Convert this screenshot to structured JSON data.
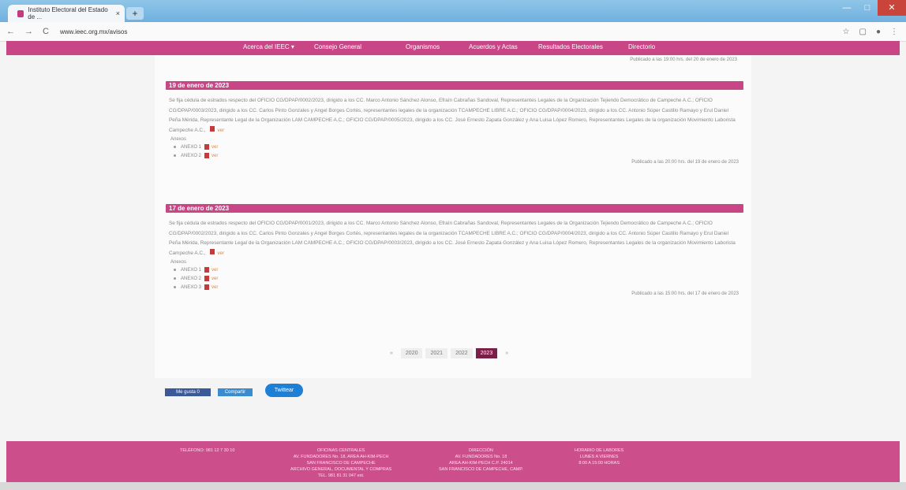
{
  "browser": {
    "tab_title": "Instituto Electoral del Estado de ...",
    "tab_close": "×",
    "new_tab": "+",
    "address": "www.ieec.org.mx/avisos",
    "nav_back": "←",
    "nav_forward": "→",
    "nav_reload": "C",
    "window_minimize": "—",
    "window_maximize": "□",
    "window_close": "✕"
  },
  "topnav": {
    "items": [
      "Acerca del IEEC ▾",
      "Consejo General",
      "Organismos",
      "Acuerdos y Actas",
      "Resultados Electorales",
      "Directorio"
    ]
  },
  "content": {
    "top_published": "Publicado a las 19:00 hrs. del 20 de enero de 2023",
    "entries": [
      {
        "date": "19 de enero de 2023",
        "text": "Se fija cédula de estrados respecto del OFICIO CG/DPAP/0002/2023, dirigido a los CC. Marco Antonio Sánchez Alonso, Efraín Cabrañas Sandoval, Representantes Legales de la Organización Tejiendo Democrático de Campeche A.C.; OFICIO CG/DPAP/0003/2023, dirigido a los CC. Carlos Pinto Gonzales y Angel Borges Cortés, representantes legales de la organización TCAMPECHE LIBRE A.C.; OFICIO CG/DPAP/0004/2023, dirigido a los CC. Antonio Súper Castillo Ramayo y Erul Daniel Peña Mérida, Representante Legal de la Organización LAM CAMPECHE A.C.; OFICIO CG/DPAP/0005/2023, dirigido a los CC. José Ernesto Zapata González y Ana Luisa López Romero, Representantes Legales de la organización Movimiento Laborista Campeche A.C.,",
        "ver": "ver",
        "anexos_label": "Anexos",
        "anexos": [
          "ANEXO 1",
          "ANEXO 2"
        ],
        "published": "Publicado a las 20:00 hrs. del 19 de enero de 2023"
      },
      {
        "date": "17 de enero de 2023",
        "text": "Se fija cédula de estrados respecto del OFICIO CG/DPAP/0001/2023, dirigido a los CC. Marco Antonio Sánchez Alonso, Efraín Cabrañas Sandoval, Representantes Legales de la Organización Tejiendo Democrático de Campeche A.C.; OFICIO CG/DPAP/0002/2023, dirigido a los CC. Carlos Pinto Gonzales y Angel Borges Cortés, representantes legales de la organización TCAMPECHE LIBRE A.C.; OFICIO CG/DPAP/0004/2023, dirigido a los CC. Antonio Súper Castillo Ramayo y Erul Daniel Peña Mérida, Representante Legal de la Organización LAM CAMPECHE A.C.; OFICIO CG/DPAP/0003/2023, dirigido a los CC. José Ernesto Zapata González y Ana Luisa López Romero, Representantes Legales de la organización Movimiento Laborista Campeche A.C.,",
        "ver": "ver",
        "anexos_label": "Anexos",
        "anexos": [
          "ANEXO 1",
          "ANEXO 2",
          "ANEXO 3"
        ],
        "published": "Publicado a las 15:00 hrs. del 17 de enero de 2023"
      }
    ],
    "pager": {
      "prev": "«",
      "years": [
        "2020",
        "2021",
        "2022",
        "2023"
      ],
      "active": "2023",
      "next": "»"
    }
  },
  "social": {
    "fb_like": "Me gusta 0",
    "fb_share": "Compartir",
    "tweet": "Twittear"
  },
  "footer": {
    "col1": [
      "TELÉFONO: 981 12 7 30 10"
    ],
    "col2": [
      "OFICINAS CENTRALES",
      "AV. FUNDADORES No. 18, AREA AH-KIM-PECH",
      "SAN FRANCISCO DE CAMPECHE",
      "ARCHIVO GENERAL, DOCUMENTAL Y COMPRAS",
      "TEL. 981 81 31 047 ext."
    ],
    "col3": [
      "DIRECCIÓN",
      "AV. FUNDADORES No. 18",
      "AREA AH-KIM-PECH C.P. 24014",
      "SAN FRANCISCO DE CAMPECHE, CAMP."
    ],
    "col4": [
      "HORARIO DE LABORES",
      "LUNES A VIERNES",
      "8:00 A 15:00 HORAS"
    ]
  },
  "colors": {
    "brand_pink": "#c84686",
    "active_page": "#7a1f47"
  }
}
